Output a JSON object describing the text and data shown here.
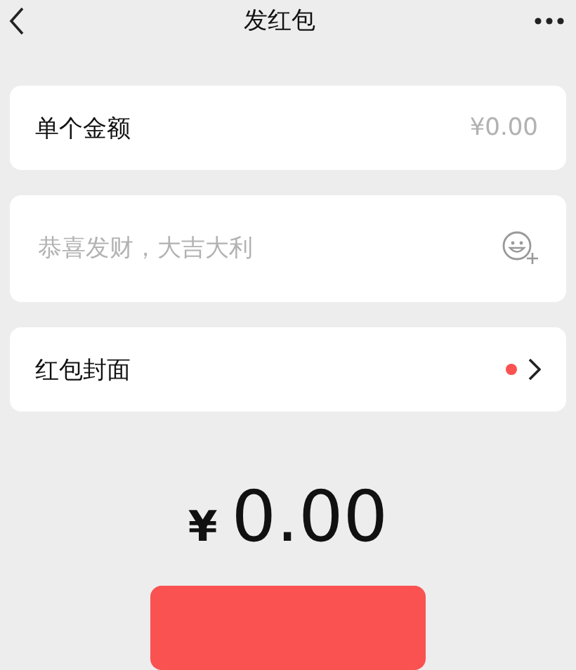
{
  "nav": {
    "title": "发红包"
  },
  "amount_row": {
    "label": "单个金额",
    "placeholder": "¥0.00"
  },
  "greeting": {
    "placeholder": "恭喜发财，大吉大利"
  },
  "cover_row": {
    "label": "红包封面",
    "has_new": true
  },
  "total": {
    "currency": "¥",
    "amount": "0.00"
  }
}
